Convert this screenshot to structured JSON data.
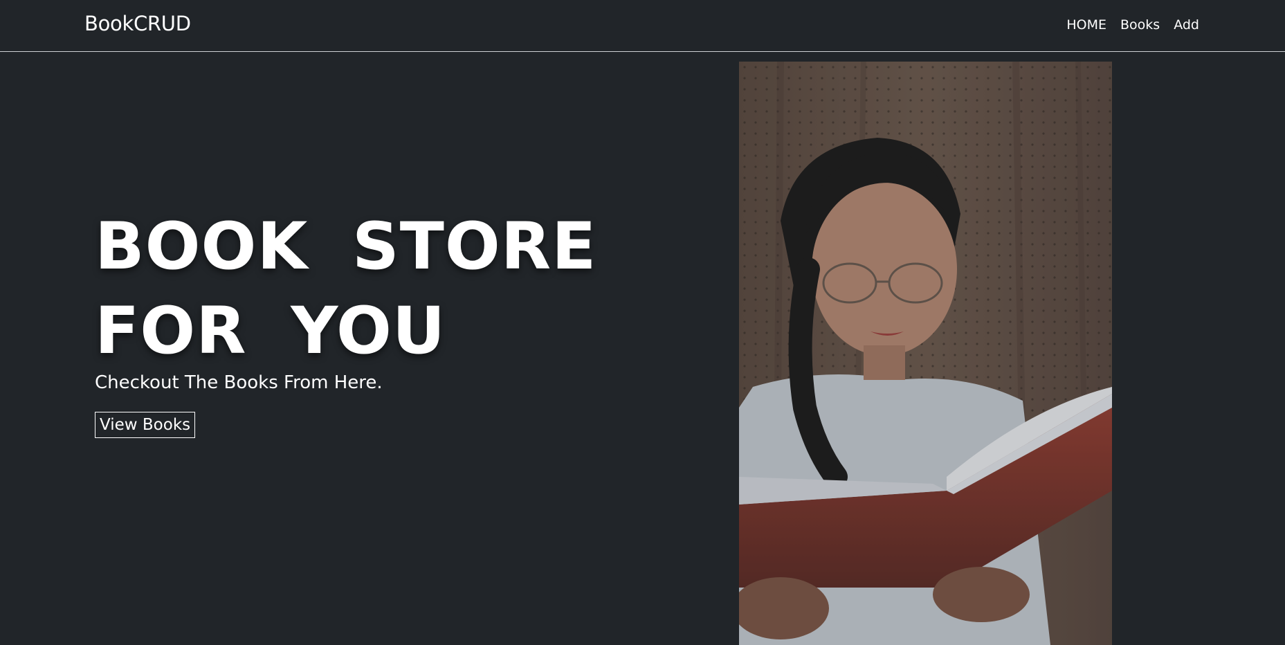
{
  "navbar": {
    "brand": "BookCRUD",
    "links": [
      {
        "label": "HOME"
      },
      {
        "label": "Books"
      },
      {
        "label": "Add"
      }
    ]
  },
  "hero": {
    "title_line1": "BOOK STORE",
    "title_line2": "FOR YOU",
    "subtitle": "Checkout The Books From Here.",
    "button_label": "View Books"
  },
  "colors": {
    "background": "#212529",
    "text": "#ffffff",
    "divider": "#cfd2d6"
  }
}
